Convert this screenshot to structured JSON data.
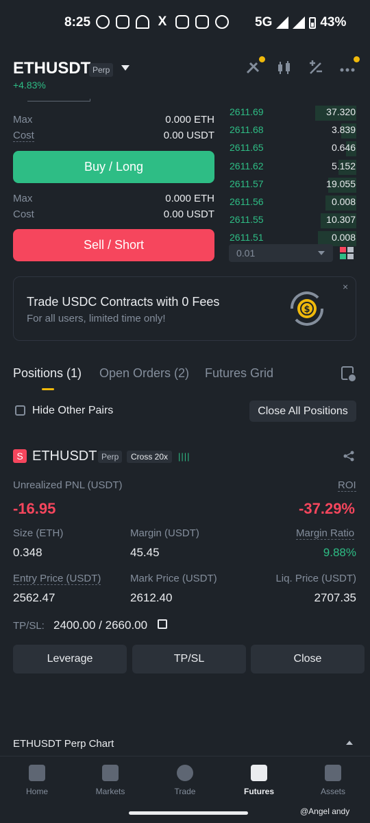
{
  "status_bar": {
    "time": "8:25",
    "network": "5G",
    "battery": "43%",
    "app_icons": [
      "whatsapp-icon",
      "chat-icon",
      "missed-call-icon",
      "x-icon",
      "instagram-icon",
      "instagram-icon",
      "opera-icon"
    ]
  },
  "header": {
    "pair": "ETHUSDT",
    "badge": "Perp",
    "change": "+4.83%",
    "icons": [
      "strategy-icon",
      "candles-icon",
      "calculator-icon",
      "more-icon"
    ]
  },
  "order_form": {
    "buy": {
      "max_label": "Max",
      "max_value": "0.000 ETH",
      "cost_label": "Cost",
      "cost_value": "0.00 USDT",
      "button": "Buy / Long"
    },
    "sell": {
      "max_label": "Max",
      "max_value": "0.000 ETH",
      "cost_label": "Cost",
      "cost_value": "0.00 USDT",
      "button": "Sell / Short"
    }
  },
  "order_book": {
    "bids": [
      {
        "price": "2611.69",
        "qty": "37.320",
        "depth": 0.32
      },
      {
        "price": "2611.68",
        "qty": "3.839",
        "depth": 0.12
      },
      {
        "price": "2611.65",
        "qty": "0.646",
        "depth": 0.08
      },
      {
        "price": "2611.62",
        "qty": "5.152",
        "depth": 0.14
      },
      {
        "price": "2611.57",
        "qty": "19.055",
        "depth": 0.22
      },
      {
        "price": "2611.56",
        "qty": "0.008",
        "depth": 0.24
      },
      {
        "price": "2611.55",
        "qty": "10.307",
        "depth": 0.28
      },
      {
        "price": "2611.51",
        "qty": "0.008",
        "depth": 0.3
      }
    ],
    "precision": "0.01"
  },
  "promo": {
    "title": "Trade USDC Contracts with 0 Fees",
    "subtitle": "For all users, limited time only!",
    "close": "×"
  },
  "tabs": [
    {
      "label": "Positions (1)",
      "active": true
    },
    {
      "label": "Open Orders (2)",
      "active": false
    },
    {
      "label": "Futures Grid",
      "active": false
    }
  ],
  "filters": {
    "hide_other_pairs": "Hide Other Pairs",
    "close_all": "Close All Positions"
  },
  "position": {
    "side": "S",
    "symbol": "ETHUSDT",
    "type": "Perp",
    "margin_mode": "Cross 20x",
    "bars": "||||",
    "pnl_label": "Unrealized PNL (USDT)",
    "pnl_value": "-16.95",
    "roi_label": "ROI",
    "roi_value": "-37.29%",
    "size_label": "Size (ETH)",
    "size_value": "0.348",
    "margin_label": "Margin (USDT)",
    "margin_value": "45.45",
    "margin_ratio_label": "Margin Ratio",
    "margin_ratio_value": "9.88%",
    "entry_label": "Entry Price (USDT)",
    "entry_value": "2562.47",
    "mark_label": "Mark Price (USDT)",
    "mark_value": "2612.40",
    "liq_label": "Liq. Price (USDT)",
    "liq_value": "2707.35",
    "tpsl_label": "TP/SL:",
    "tpsl_value": "2400.00 / 2660.00",
    "actions": [
      "Leverage",
      "TP/SL",
      "Close"
    ]
  },
  "chart_section": {
    "label": "ETHUSDT Perp Chart"
  },
  "bottom_nav": [
    {
      "label": "Home",
      "icon": "home-icon",
      "active": false
    },
    {
      "label": "Markets",
      "icon": "markets-icon",
      "active": false
    },
    {
      "label": "Trade",
      "icon": "trade-icon",
      "active": false
    },
    {
      "label": "Futures",
      "icon": "futures-icon",
      "active": true
    },
    {
      "label": "Assets",
      "icon": "assets-icon",
      "active": false
    }
  ],
  "watermark": "@Angel andy",
  "colors": {
    "green": "#2ebd85",
    "red": "#f6465d",
    "accent": "#f0b90b",
    "bg": "#1e2329"
  }
}
